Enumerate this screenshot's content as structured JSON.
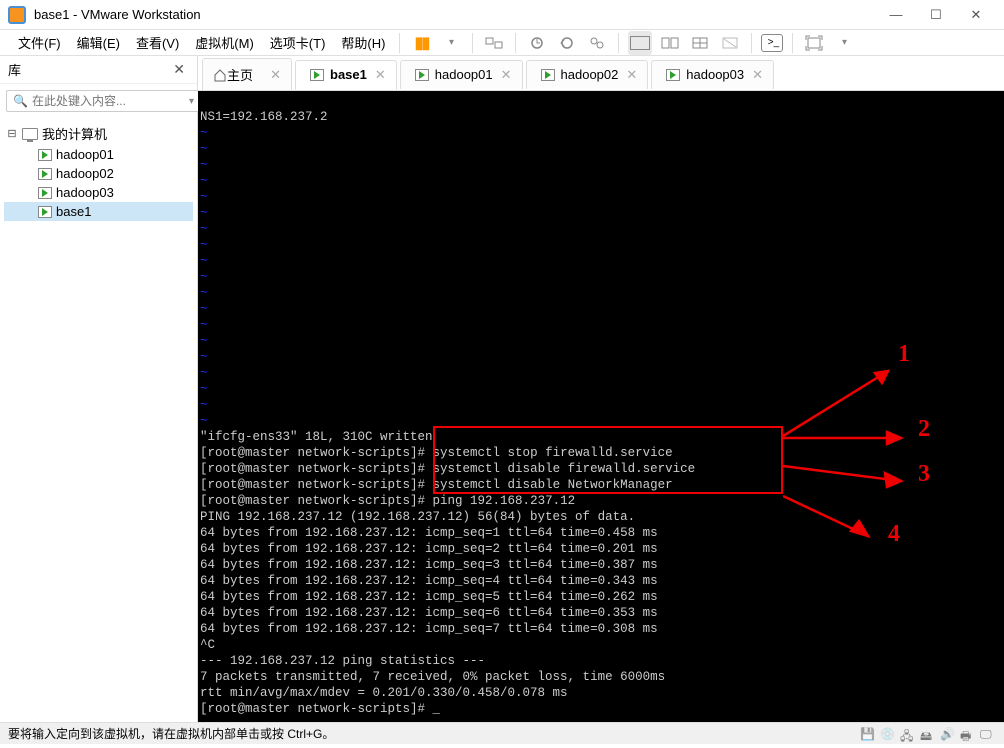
{
  "window": {
    "title": "base1 - VMware Workstation"
  },
  "menu": [
    "文件(F)",
    "编辑(E)",
    "查看(V)",
    "虚拟机(M)",
    "选项卡(T)",
    "帮助(H)"
  ],
  "sidebar": {
    "title": "库",
    "search_placeholder": "在此处键入内容...",
    "root": "我的计算机",
    "items": [
      "hadoop01",
      "hadoop02",
      "hadoop03",
      "base1"
    ]
  },
  "tabs": [
    {
      "label": "主页",
      "kind": "home"
    },
    {
      "label": "base1",
      "kind": "vm",
      "active": true
    },
    {
      "label": "hadoop01",
      "kind": "vm"
    },
    {
      "label": "hadoop02",
      "kind": "vm"
    },
    {
      "label": "hadoop03",
      "kind": "vm"
    }
  ],
  "terminal": {
    "top": "NS1=192.168.237.2",
    "written": "\"ifcfg-ens33\" 18L, 310C written",
    "prompts": [
      {
        "p": "[root@master network-scripts]# ",
        "c": "systemctl stop firewalld.service"
      },
      {
        "p": "[root@master network-scripts]# ",
        "c": "systemctl disable firewalld.service"
      },
      {
        "p": "[root@master network-scripts]# ",
        "c": "systemctl disable NetworkManager"
      },
      {
        "p": "[root@master network-scripts]# ",
        "c": "ping 192.168.237.12"
      }
    ],
    "ping_header": "PING 192.168.237.12 (192.168.237.12) 56(84) bytes of data.",
    "ping_lines": [
      "64 bytes from 192.168.237.12: icmp_seq=1 ttl=64 time=0.458 ms",
      "64 bytes from 192.168.237.12: icmp_seq=2 ttl=64 time=0.201 ms",
      "64 bytes from 192.168.237.12: icmp_seq=3 ttl=64 time=0.387 ms",
      "64 bytes from 192.168.237.12: icmp_seq=4 ttl=64 time=0.343 ms",
      "64 bytes from 192.168.237.12: icmp_seq=5 ttl=64 time=0.262 ms",
      "64 bytes from 192.168.237.12: icmp_seq=6 ttl=64 time=0.353 ms",
      "64 bytes from 192.168.237.12: icmp_seq=7 ttl=64 time=0.308 ms"
    ],
    "ctrl_c": "^C",
    "stats1": "--- 192.168.237.12 ping statistics ---",
    "stats2": "7 packets transmitted, 7 received, 0% packet loss, time 6000ms",
    "stats3": "rtt min/avg/max/mdev = 0.201/0.330/0.458/0.078 ms",
    "final_prompt": "[root@master network-scripts]# _"
  },
  "annotations": [
    "1",
    "2",
    "3",
    "4"
  ],
  "statusbar": {
    "text": "要将输入定向到该虚拟机，请在虚拟机内部单击或按 Ctrl+G。"
  },
  "watermark": ""
}
